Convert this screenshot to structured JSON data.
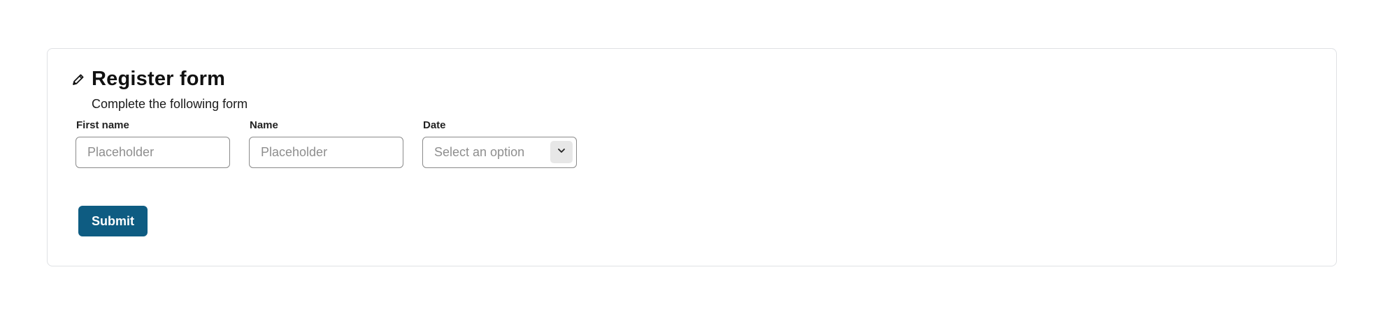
{
  "form": {
    "title": "Register form",
    "subtitle": "Complete the following form",
    "icon": "pencil-icon",
    "fields": {
      "first_name": {
        "label": "First name",
        "placeholder": "Placeholder",
        "value": ""
      },
      "name": {
        "label": "Name",
        "placeholder": "Placeholder",
        "value": ""
      },
      "date": {
        "label": "Date",
        "selected": "Select an option",
        "icon": "chevron-down-icon"
      }
    },
    "submit_label": "Submit"
  },
  "colors": {
    "accent": "#0e5c82",
    "border": "#8a8a8a",
    "card_border": "#dfe1e4",
    "placeholder": "#8e8e8e"
  }
}
